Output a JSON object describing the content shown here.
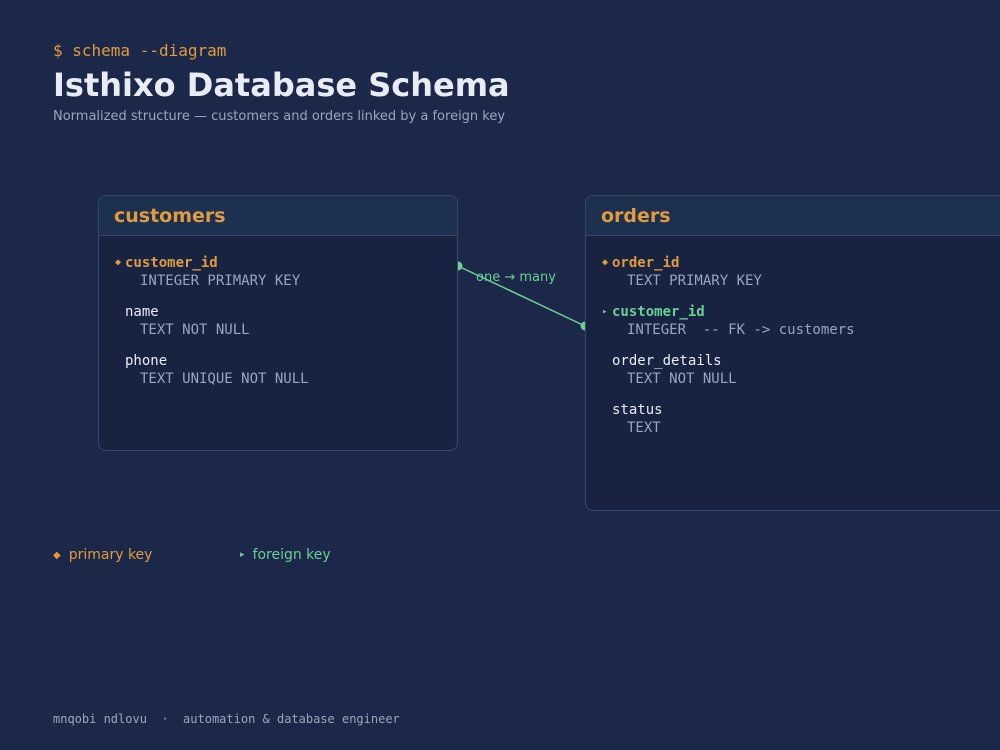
{
  "header": {
    "prompt": "$ schema --diagram",
    "title": "Isthixo Database Schema",
    "subtitle": "Normalized structure — customers and orders linked by a foreign key"
  },
  "tables": [
    {
      "name": "customers",
      "columns": [
        {
          "name": "customer_id",
          "type": "INTEGER PRIMARY KEY",
          "key": "pk"
        },
        {
          "name": "name",
          "type": "TEXT NOT NULL",
          "key": ""
        },
        {
          "name": "phone",
          "type": "TEXT UNIQUE NOT NULL",
          "key": ""
        }
      ]
    },
    {
      "name": "orders",
      "columns": [
        {
          "name": "order_id",
          "type": "TEXT PRIMARY KEY",
          "key": "pk"
        },
        {
          "name": "customer_id",
          "type": "INTEGER  -- FK -> customers",
          "key": "fk"
        },
        {
          "name": "order_details",
          "type": "TEXT NOT NULL",
          "key": ""
        },
        {
          "name": "status",
          "type": "TEXT",
          "key": ""
        }
      ]
    }
  ],
  "relationship": {
    "label": "one → many",
    "color": "#6ccf94"
  },
  "legend": {
    "pk_marker": "◆",
    "pk_label": "primary key",
    "fk_marker": "▸",
    "fk_label": "foreign key"
  },
  "colors": {
    "background": "#1c2849",
    "primary_key": "#e09b3d",
    "foreign_key": "#6ccf94"
  },
  "footer": "mnqobi ndlovu  ·  automation & database engineer"
}
